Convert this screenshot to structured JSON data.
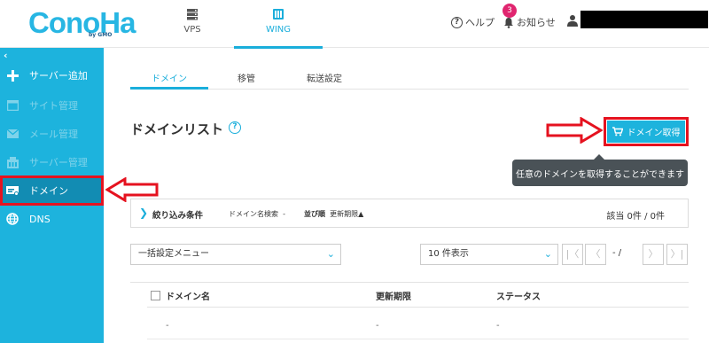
{
  "header": {
    "logo_text": "ConoHa",
    "logo_sub": "by GMO",
    "nav": [
      {
        "label": "VPS",
        "icon": "server-icon"
      },
      {
        "label": "WING",
        "icon": "wing-icon"
      }
    ],
    "help_label": "ヘルプ",
    "notice_label": "お知らせ",
    "notice_count": "3"
  },
  "sidebar": {
    "collapse_glyph": "‹",
    "items": [
      {
        "label": "サーバー追加",
        "icon": "plus-icon",
        "state": "normal"
      },
      {
        "label": "サイト管理",
        "icon": "site-icon",
        "state": "disabled"
      },
      {
        "label": "メール管理",
        "icon": "mail-icon",
        "state": "disabled"
      },
      {
        "label": "サーバー管理",
        "icon": "server-manage-icon",
        "state": "disabled"
      },
      {
        "label": "ドメイン",
        "icon": "domain-icon",
        "state": "active"
      },
      {
        "label": "DNS",
        "icon": "globe-icon",
        "state": "normal"
      }
    ]
  },
  "tabs": [
    {
      "label": "ドメイン",
      "active": true
    },
    {
      "label": "移管",
      "active": false
    },
    {
      "label": "転送設定",
      "active": false
    }
  ],
  "page": {
    "title": "ドメインリスト",
    "help_glyph": "?",
    "get_button_label": "ドメイン取得",
    "tooltip": "任意のドメインを取得することができます"
  },
  "filter": {
    "title": "絞り込み条件",
    "search_label": "ドメイン名検索",
    "search_value": "-",
    "sort_label": "並び順",
    "sort_value": "更新期限▲",
    "count_text": "該当 0件 / 0件"
  },
  "controls": {
    "bulk_menu_value": "一括設定メニュー",
    "per_page_value": "10 件表示",
    "page_first": "|〈",
    "page_prev": "〈",
    "page_range": "-  /",
    "page_next": "〉",
    "page_last": "〉|"
  },
  "table": {
    "headers": [
      "ドメイン名",
      "更新期限",
      "ステータス"
    ],
    "rows": [
      [
        "-",
        "-",
        "-"
      ]
    ]
  },
  "colors": {
    "brand": "#1db3dd",
    "sidebar_active": "#128cb3",
    "annotation_red": "#e5121f",
    "badge": "#e0256f",
    "tooltip_bg": "#4a5257"
  }
}
